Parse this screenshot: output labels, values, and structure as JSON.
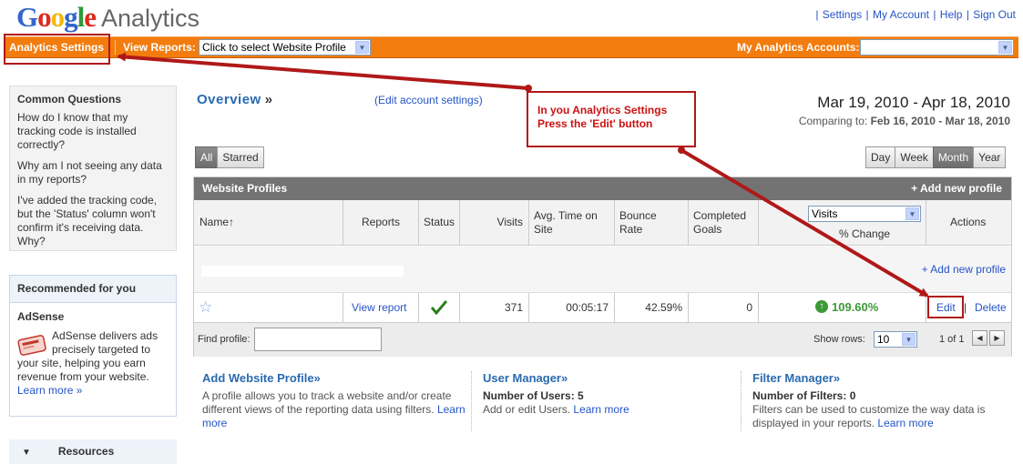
{
  "header": {
    "logo_letters": [
      "G",
      "o",
      "o",
      "g",
      "l",
      "e"
    ],
    "logo_colors": [
      "#3366cc",
      "#dd2b1f",
      "#f2b90d",
      "#3366cc",
      "#2e9a3a",
      "#dd2b1f"
    ],
    "product": "Analytics",
    "links": [
      "Settings",
      "My Account",
      "Help",
      "Sign Out"
    ]
  },
  "navbar": {
    "analytics_settings": "Analytics Settings",
    "view_reports_label": "View Reports:",
    "view_reports_value": "Click to select Website Profile",
    "accounts_label": "My Analytics Accounts:",
    "accounts_value": ""
  },
  "sidebar": {
    "common_questions": {
      "title": "Common Questions",
      "items": [
        "How do I know that my tracking code is installed correctly?",
        "Why am I not seeing any data in my reports?",
        "I've added the tracking code, but the 'Status' column won't confirm it's receiving data. Why?"
      ]
    },
    "recommended": {
      "title": "Recommended for you",
      "product": "AdSense",
      "text": "AdSense delivers ads precisely targeted to your site, helping you earn revenue from your website.",
      "learn_more": "Learn more »"
    },
    "resources": "Resources"
  },
  "main": {
    "overview": "Overview",
    "overview_arrow": "»",
    "edit_account": "(Edit account settings)",
    "date_range": "Mar 19, 2010 - Apr 18, 2010",
    "comparing_label": "Comparing to:",
    "comparing_range": "Feb 16, 2010 - Mar 18, 2010",
    "filter_tabs": [
      "All",
      "Starred"
    ],
    "period_tabs": [
      "Day",
      "Week",
      "Month",
      "Year"
    ],
    "active_period": "Month"
  },
  "table": {
    "title": "Website Profiles",
    "add_new": "+ Add new profile",
    "columns": {
      "name": "Name↑",
      "reports": "Reports",
      "status": "Status",
      "visits": "Visits",
      "avg_time": "Avg. Time on Site",
      "bounce": "Bounce Rate",
      "goals": "Completed Goals",
      "metric_select": "Visits",
      "change": "% Change",
      "actions": "Actions"
    },
    "add_new_inline": "+ Add new profile",
    "row": {
      "view_report": "View report",
      "visits": "371",
      "avg_time": "00:05:17",
      "bounce": "42.59%",
      "goals": "0",
      "change": "109.60%",
      "edit": "Edit",
      "delete": "Delete"
    },
    "footer": {
      "find_label": "Find profile:",
      "show_rows_label": "Show rows:",
      "show_rows_value": "10",
      "pager": "1 of 1"
    }
  },
  "bottom": {
    "add_profile": {
      "title": "Add Website Profile»",
      "text": "A profile allows you to track a website and/or create different views of the reporting data using filters.",
      "learn_more": "Learn more"
    },
    "user_manager": {
      "title": "User Manager»",
      "count_label": "Number of Users:",
      "count": "5",
      "text": "Add or edit Users.",
      "learn_more": "Learn more"
    },
    "filter_manager": {
      "title": "Filter Manager»",
      "count_label": "Number of Filters:",
      "count": "0",
      "text": "Filters can be used to customize the way data is displayed in your reports.",
      "learn_more": "Learn more"
    }
  },
  "annotation": {
    "line1": "In you Analytics Settings",
    "line2": "Press the 'Edit' button",
    "color": "#b01818"
  }
}
